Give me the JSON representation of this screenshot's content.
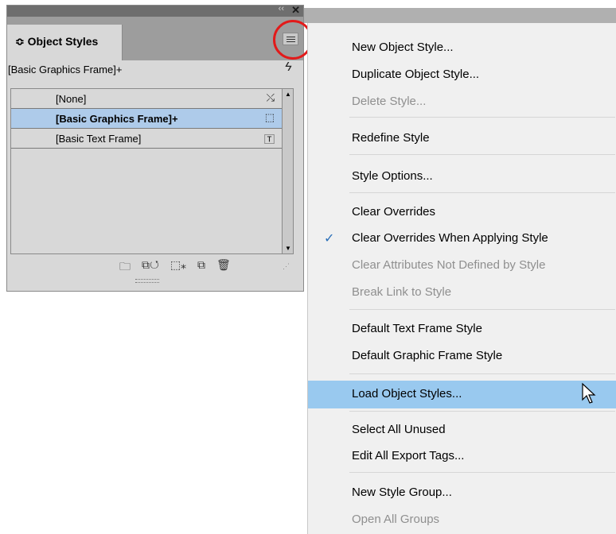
{
  "panel": {
    "tab_label": "≎ Object Styles",
    "collapse_glyph": "‹‹",
    "close_glyph": "✕",
    "current_style": "[Basic Graphics Frame]+",
    "lightning_glyph": "ϟ",
    "styles": [
      {
        "label": "[None]",
        "icon": "⤯"
      },
      {
        "label": "[Basic Graphics Frame]+",
        "icon": "⬚"
      },
      {
        "label": "[Basic Text Frame]",
        "icon": "🅃"
      }
    ],
    "footer_icons": [
      "🗀",
      "⧉↺",
      "⬚⁎",
      "⧉",
      "🗑"
    ]
  },
  "menu": {
    "items": [
      {
        "label": "New Object Style..."
      },
      {
        "label": "Duplicate Object Style..."
      },
      {
        "label": "Delete Style..."
      },
      {
        "label": "Redefine Style"
      },
      {
        "label": "Style Options..."
      },
      {
        "label": "Clear Overrides"
      },
      {
        "label": "Clear Overrides When Applying Style"
      },
      {
        "label": "Clear Attributes Not Defined by Style"
      },
      {
        "label": "Break Link to Style"
      },
      {
        "label": "Default Text Frame Style"
      },
      {
        "label": "Default Graphic Frame Style"
      },
      {
        "label": "Load Object Styles..."
      },
      {
        "label": "Select All Unused"
      },
      {
        "label": "Edit All Export Tags..."
      },
      {
        "label": "New Style Group..."
      },
      {
        "label": "Open All Groups"
      }
    ],
    "checked_glyph": "✓"
  }
}
